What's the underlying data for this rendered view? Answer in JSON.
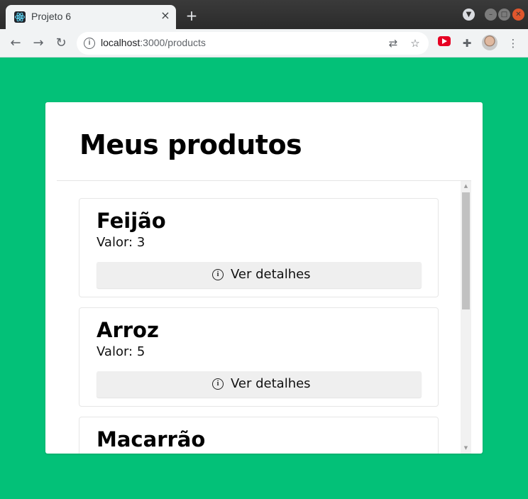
{
  "browser": {
    "tab_title": "Projeto 6",
    "tab_close": "×",
    "new_tab": "+",
    "url_host": "localhost",
    "url_path": ":3000/products"
  },
  "page": {
    "title": "Meus produtos"
  },
  "products": [
    {
      "name": "Feijão",
      "value_label": "Valor: 3",
      "button_label": "Ver detalhes"
    },
    {
      "name": "Arroz",
      "value_label": "Valor: 5",
      "button_label": "Ver detalhes"
    },
    {
      "name": "Macarrão"
    }
  ],
  "colors": {
    "background": "#03c178",
    "card": "#ffffff",
    "button": "#efefef"
  },
  "icons": {
    "favicon": "react-icon",
    "details": "info-icon",
    "back": "back-arrow-icon",
    "forward": "forward-arrow-icon",
    "reload": "reload-icon",
    "site_info": "info-icon",
    "translate": "translate-icon",
    "bookmark": "star-icon",
    "youtube": "youtube-icon",
    "extensions": "puzzle-icon",
    "menu": "kebab-menu-icon"
  }
}
